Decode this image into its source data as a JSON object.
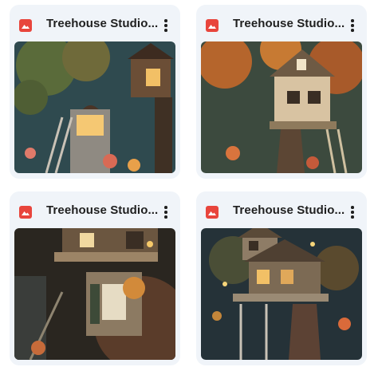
{
  "files": [
    {
      "name": "Treehouse Studio...",
      "icon": "image-file-icon",
      "bg": "#2f4a4f"
    },
    {
      "name": "Treehouse Studio...",
      "icon": "image-file-icon",
      "bg": "#3c4a3e"
    },
    {
      "name": "Treehouse Studio...",
      "icon": "image-file-icon",
      "bg": "#2a2620"
    },
    {
      "name": "Treehouse Studio...",
      "icon": "image-file-icon",
      "bg": "#253238"
    }
  ],
  "colors": {
    "card_bg": "#f0f4f9",
    "file_icon": "#e8453c",
    "title_text": "#1f1f1f"
  }
}
